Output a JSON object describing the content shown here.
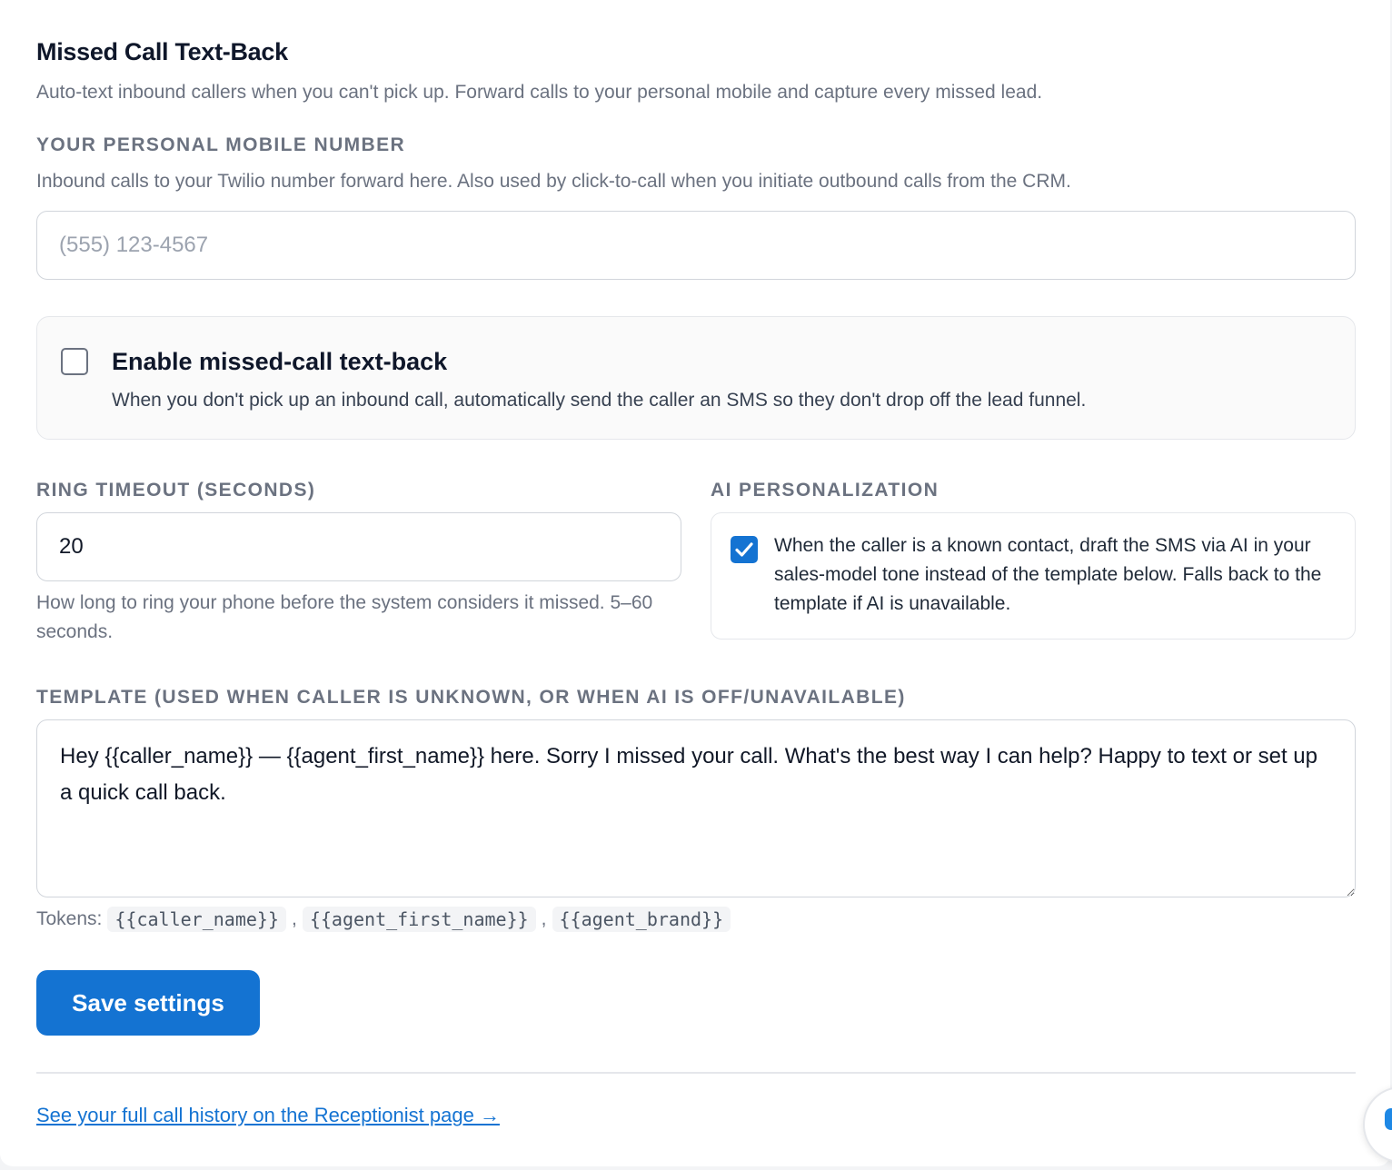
{
  "section": {
    "title": "Missed Call Text-Back",
    "subtitle": "Auto-text inbound callers when you can't pick up. Forward calls to your personal mobile and capture every missed lead."
  },
  "mobile": {
    "label": "Your personal mobile number",
    "help": "Inbound calls to your Twilio number forward here. Also used by click-to-call when you initiate outbound calls from the CRM.",
    "value": "",
    "placeholder": "(555) 123-4567"
  },
  "enable": {
    "title": "Enable missed-call text-back",
    "description": "When you don't pick up an inbound call, automatically send the caller an SMS so they don't drop off the lead funnel.",
    "checked": false
  },
  "ring_timeout": {
    "label": "Ring timeout (seconds)",
    "value": "20",
    "help": "How long to ring your phone before the system considers it missed. 5–60 seconds."
  },
  "ai": {
    "label": "AI Personalization",
    "text": "When the caller is a known contact, draft the SMS via AI in your sales-model tone instead of the template below. Falls back to the template if AI is unavailable.",
    "checked": true
  },
  "template": {
    "label": "Template (used when caller is unknown, or when AI is off/unavailable)",
    "value": "Hey {{caller_name}} — {{agent_first_name}} here. Sorry I missed your call. What's the best way I can help? Happy to text or set up a quick call back.",
    "tokens_label": "Tokens:",
    "tokens": [
      "{{caller_name}}",
      "{{agent_first_name}}",
      "{{agent_brand}}"
    ],
    "separator": ","
  },
  "actions": {
    "save_label": "Save settings"
  },
  "footer": {
    "link_text": "See your full call history on the Receptionist page →"
  },
  "colors": {
    "accent": "#1473d2",
    "muted_text": "#6b7280",
    "border": "#d1d5db"
  }
}
